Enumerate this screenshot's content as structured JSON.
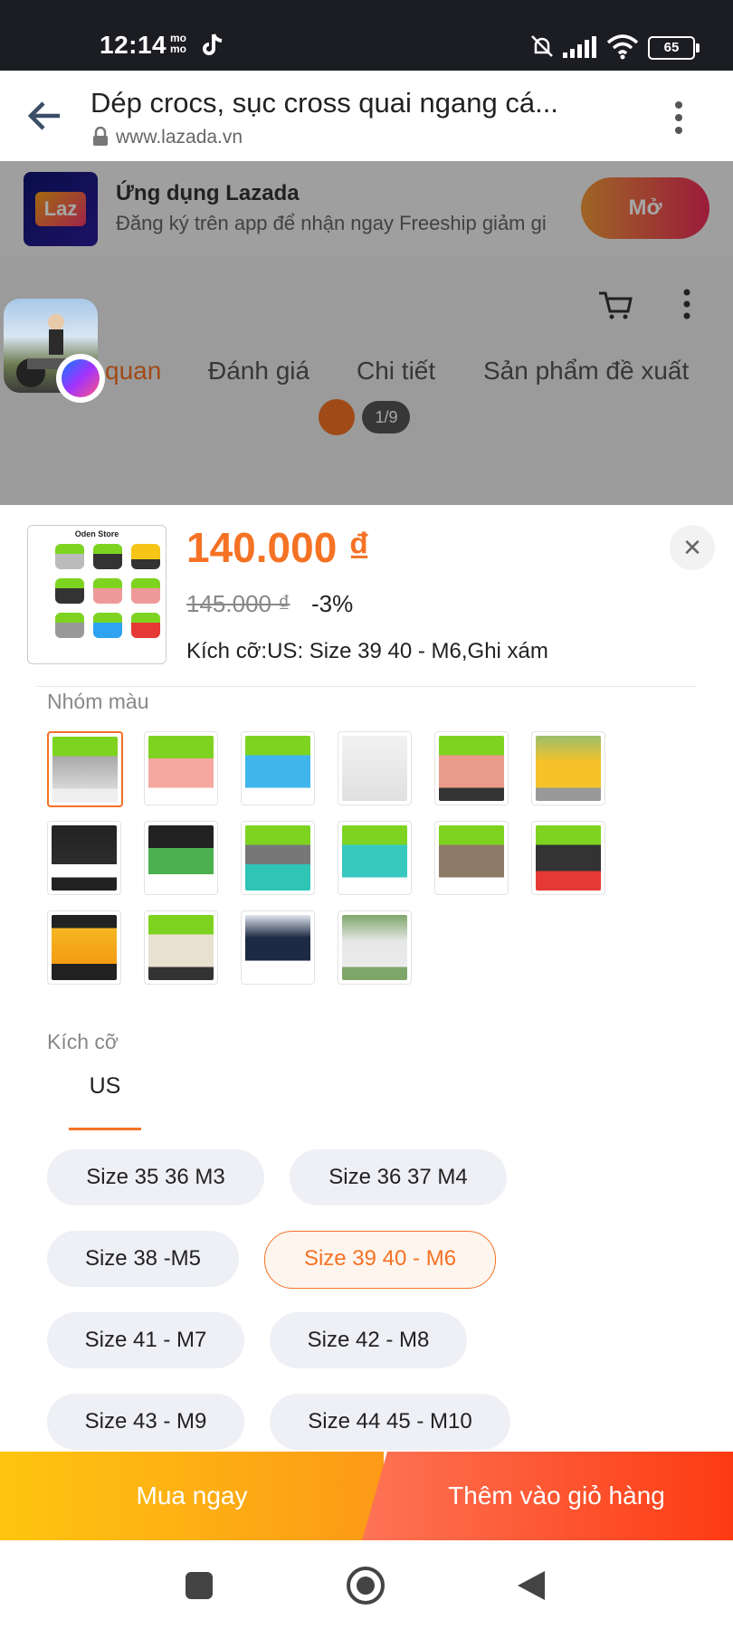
{
  "status": {
    "time": "12:14",
    "carrier_icon": "mo-mo",
    "battery": "65"
  },
  "browser": {
    "title": "Dép crocs, sục cross quai ngang cá...",
    "url": "www.lazada.vn"
  },
  "banner": {
    "title": "Ứng dụng Lazada",
    "subtitle": "Đăng ký trên app để nhận ngay Freeship giảm gi",
    "logo": "Laz",
    "open_label": "Mở"
  },
  "page_tabs": [
    "quan",
    "Đánh giá",
    "Chi tiết",
    "Sản phẩm đề xuất"
  ],
  "media_counter": "1/9",
  "product": {
    "thumb_label": "Oden Store",
    "price": "140.000 ₫",
    "old_price": "145.000 ₫",
    "discount": "-3%",
    "selection": "Kích cỡ:US: Size 39 40 - M6,Ghi xám"
  },
  "color_section": {
    "label": "Nhóm màu",
    "selected_index": 0
  },
  "size_section": {
    "label": "Kích cỡ",
    "tab": "US",
    "options": [
      "Size 35 36 M3",
      "Size 36 37 M4",
      "Size 38 -M5",
      "Size 39 40 - M6",
      "Size 41 - M7",
      "Size 42 - M8",
      "Size 43 - M9",
      "Size 44 45 - M10"
    ],
    "selected": "Size 39 40 - M6"
  },
  "actions": {
    "buy_now": "Mua ngay",
    "add_to_cart": "Thêm vào giỏ hàng"
  },
  "colors": {
    "accent": "#f57224",
    "buy_now": "#fec510",
    "add_to_cart": "#fd3b12"
  }
}
